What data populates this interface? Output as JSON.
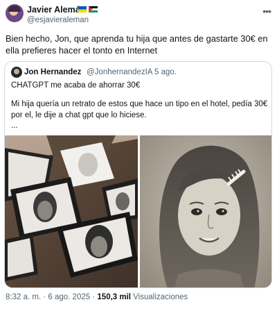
{
  "author": {
    "name": "Javier Alemán",
    "handle": "@esjavieraleman"
  },
  "post": {
    "text": "Bien hecho, Jon, que aprenda tu hija que antes de gastarte 30€ en ella prefieres hacer el tonto en Internet"
  },
  "quoted": {
    "name": "Jon Hernandez",
    "handle": "@JonhernandezIA",
    "separator": "·",
    "date": "5 ago.",
    "line1": "CHATGPT me acaba de ahorrar 30€",
    "line2": "Mi hija quería un retrato de estos que hace un tipo en el hotel, pedía 30€ por el, le dije a chat gpt que lo hiciese.",
    "ellipsis": "..."
  },
  "footer": {
    "time": "8:32 a. m.",
    "dot1": "·",
    "date": "6 ago. 2025",
    "dot2": "·",
    "views_count": "150,3 mil",
    "views_label": "Visualizaciones"
  },
  "icons": {
    "more": "more-horizontal-icon",
    "flags": [
      "ukraine-flag-icon",
      "palestine-flag-icon"
    ]
  },
  "colors": {
    "text": "#0f1419",
    "secondary": "#536471",
    "border": "#cfd9de"
  }
}
